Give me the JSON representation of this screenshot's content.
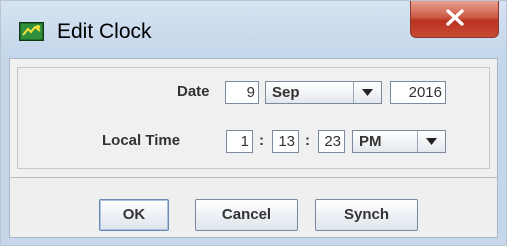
{
  "window": {
    "title": "Edit Clock",
    "app_icon": "clock-edit-icon",
    "close_icon": "close-icon"
  },
  "form": {
    "date_label": "Date",
    "day": "9",
    "month": "Sep",
    "year": "2016",
    "time_label": "Local Time",
    "hour": "1",
    "minute": "13",
    "second": "23",
    "ampm": "PM",
    "separator": ":"
  },
  "buttons": {
    "ok": "OK",
    "cancel": "Cancel",
    "synch": "Synch"
  },
  "colors": {
    "titlebar": "#c6d7ea",
    "close_button": "#c84b34",
    "dialog_bg": "#f0f0f0"
  }
}
